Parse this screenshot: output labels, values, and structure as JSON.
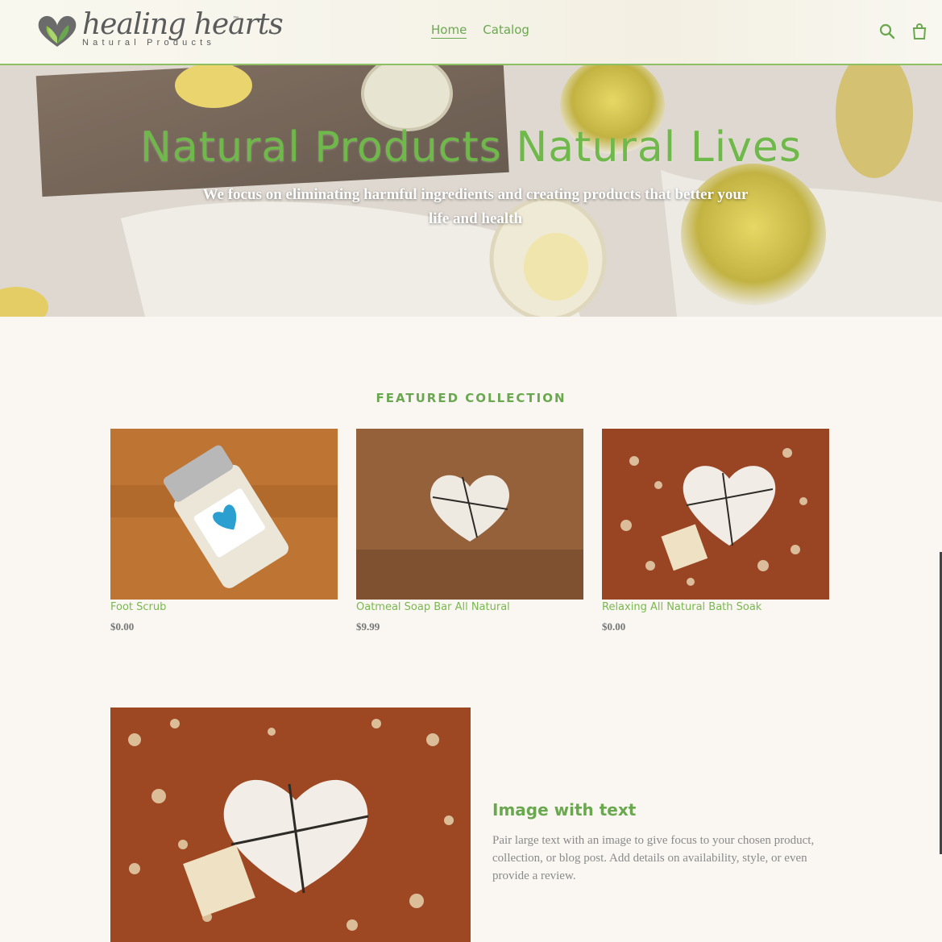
{
  "brand": {
    "name": "healing hearts",
    "tm": "™",
    "tagline": "Natural Products",
    "accent_color": "#6aa84f"
  },
  "nav": {
    "items": [
      {
        "label": "Home",
        "active": true
      },
      {
        "label": "Catalog",
        "active": false
      }
    ]
  },
  "header_icons": [
    "search-icon",
    "cart-icon"
  ],
  "hero": {
    "title": "Natural Products Natural Lives",
    "subtitle": "We focus on eliminating harmful ingredients and creating products that better your life and health"
  },
  "featured": {
    "heading": "FEATURED COLLECTION",
    "products": [
      {
        "name": "Foot Scrub",
        "price": "$0.00",
        "image": "jar-product-photo"
      },
      {
        "name": "Oatmeal Soap Bar All Natural",
        "price": "$9.99",
        "image": "heart-soap-photo"
      },
      {
        "name": "Relaxing All Natural Bath Soak",
        "price": "$0.00",
        "image": "bath-soak-photo"
      }
    ]
  },
  "image_with_text": {
    "title": "Image with text",
    "body": "Pair large text with an image to give focus to your chosen product, collection, or blog post. Add details on availability, style, or even provide a review."
  }
}
